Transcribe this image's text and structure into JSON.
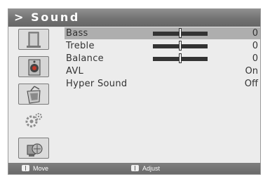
{
  "header": {
    "title": "> Sound"
  },
  "sidebar": {
    "items": [
      {
        "icon": "picture-icon"
      },
      {
        "icon": "sound-icon",
        "active": true
      },
      {
        "icon": "channel-icon"
      },
      {
        "icon": "setup-icon"
      },
      {
        "icon": "input-icon"
      }
    ]
  },
  "menu": {
    "items": [
      {
        "label": "Bass",
        "value": "0",
        "level": 0.5
      },
      {
        "label": "Treble",
        "value": "0",
        "level": 0.5
      },
      {
        "label": "Balance",
        "value": "0",
        "level": 0.5
      },
      {
        "label": "AVL",
        "value": "On"
      },
      {
        "label": "Hyper Sound",
        "value": "Off"
      }
    ]
  },
  "footer": {
    "move_label": "Move",
    "adjust_label": "Adjust"
  },
  "colors": {
    "title_bar": "#7a7a7a",
    "selected_row": "#aeaeae",
    "panel": "#ececec",
    "slider": "#333333"
  }
}
